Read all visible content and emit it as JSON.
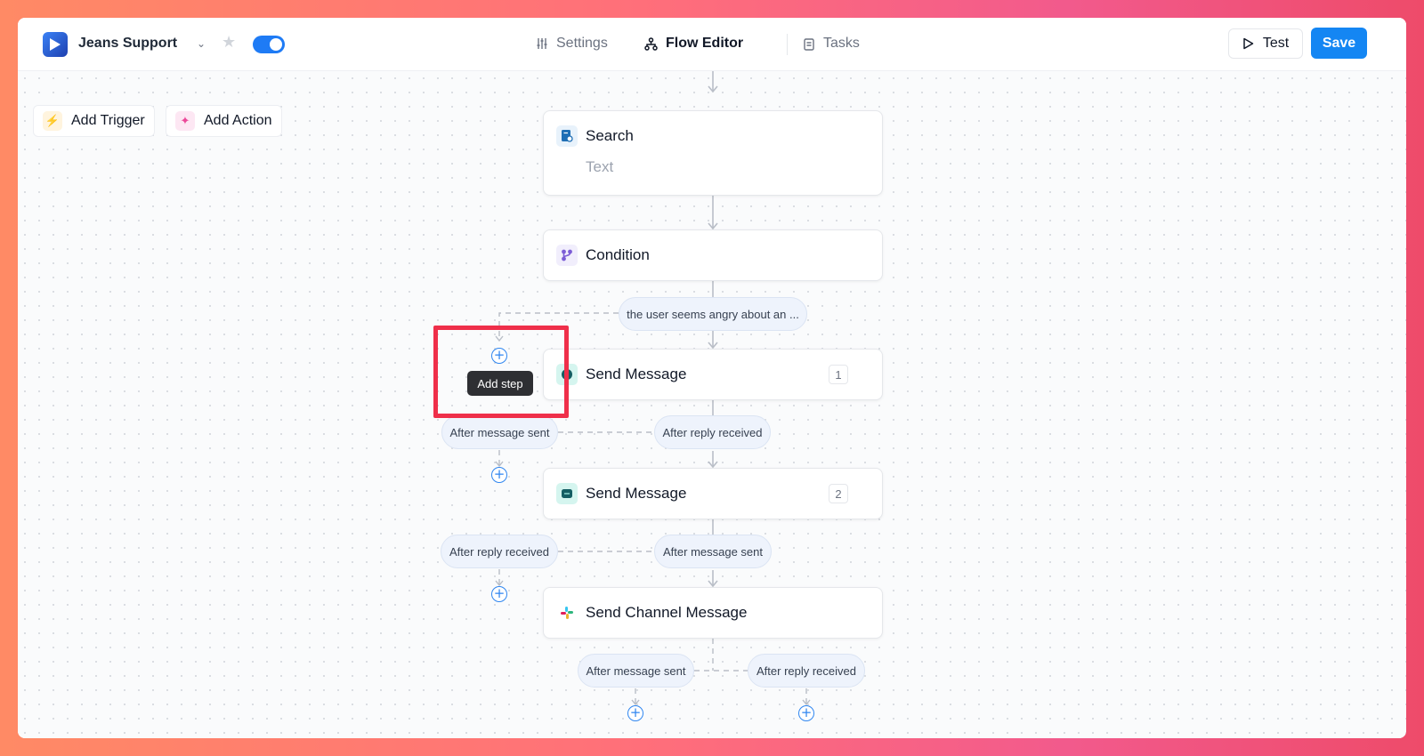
{
  "header": {
    "app_name": "Jeans Support",
    "nav": [
      {
        "label": "Settings",
        "icon": "sliders-icon"
      },
      {
        "label": "Flow Editor",
        "icon": "flow-tree-icon"
      },
      {
        "label": "Tasks",
        "icon": "clipboard-icon"
      }
    ],
    "test_label": "Test",
    "save_label": "Save",
    "toggle_on": true
  },
  "toolbar": {
    "add_trigger": "Add Trigger",
    "add_action": "Add Action"
  },
  "nodes": {
    "search": {
      "title": "Search",
      "subtitle": "Text",
      "icon": "search-document-icon"
    },
    "condition": {
      "title": "Condition",
      "icon": "branch-icon"
    },
    "send1": {
      "title": "Send Message",
      "badge": "1",
      "icon": "message-icon"
    },
    "send2": {
      "title": "Send Message",
      "badge": "2",
      "icon": "message-icon"
    },
    "channel": {
      "title": "Send Channel Message",
      "icon": "slack-icon"
    }
  },
  "branches": {
    "condition_label": "the user seems angry about an ...",
    "send1_left": "After message sent",
    "send1_right": "After reply received",
    "send2_left": "After reply received",
    "send2_right": "After message sent",
    "channel_left": "After message sent",
    "channel_right": "After reply received"
  },
  "tooltip": "Add step",
  "colors": {
    "accent": "#1486f3",
    "highlight": "#ef2f4a"
  }
}
